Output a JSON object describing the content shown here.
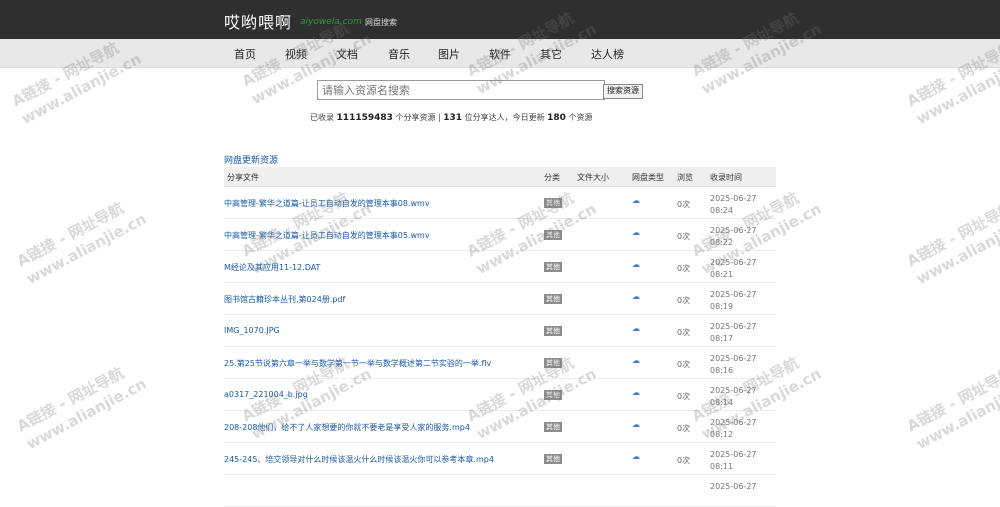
{
  "header": {
    "brand": "哎哟喂啊",
    "domain": "aiyowela.com",
    "subtitle": "网盘搜索"
  },
  "nav": [
    "首页",
    "视频",
    "文档",
    "音乐",
    "图片",
    "软件",
    "其它",
    "达人榜"
  ],
  "search": {
    "placeholder": "请输入资源名搜索",
    "button_label": "搜索资源"
  },
  "stats": {
    "prefix": "已收录",
    "total": "111159483",
    "mid1": "个分享资源 |",
    "sharers": "131",
    "mid2": "位分享达人，今日更新",
    "today": "180",
    "suffix": "个资源"
  },
  "section_title": "网盘更新资源",
  "table": {
    "headers": [
      "分享文件",
      "分类",
      "文件大小",
      "网盘类型",
      "浏览",
      "收录时间"
    ],
    "rows": [
      {
        "file": "中高管理-繁华之道篇-让员工自动自发的管理本事08.wmv",
        "category": "其他",
        "size": "",
        "views": "0次",
        "date": "2025-06-27",
        "time": "08:24"
      },
      {
        "file": "中高管理-繁华之道篇-让员工自动自发的管理本事05.wmv",
        "category": "其他",
        "size": "",
        "views": "0次",
        "date": "2025-06-27",
        "time": "08:22"
      },
      {
        "file": "M经论及其应用11-12.DAT",
        "category": "其他",
        "size": "",
        "views": "0次",
        "date": "2025-06-27",
        "time": "08:21"
      },
      {
        "file": "图书馆古籍珍本丛刊,第024册.pdf",
        "category": "其他",
        "size": "",
        "views": "0次",
        "date": "2025-06-27",
        "time": "08:19"
      },
      {
        "file": "IMG_1070.JPG",
        "category": "其他",
        "size": "",
        "views": "0次",
        "date": "2025-06-27",
        "time": "08:17"
      },
      {
        "file": "25.第25节说第六章一举与数学第一节一举与数学概述第二节实验的一举.flv",
        "category": "其他",
        "size": "",
        "views": "0次",
        "date": "2025-06-27",
        "time": "08:16"
      },
      {
        "file": "a0317_221004_b.jpg",
        "category": "其他",
        "size": "",
        "views": "0次",
        "date": "2025-06-27",
        "time": "08:14"
      },
      {
        "file": "208-208他们，给不了人家想要的你就不要老是享受人家的服务.mp4",
        "category": "其他",
        "size": "",
        "views": "0次",
        "date": "2025-06-27",
        "time": "08:12"
      },
      {
        "file": "245-245、培交领导对什么时候该温火什么时候该温火你可以参考本章.mp4",
        "category": "其他",
        "size": "",
        "views": "0次",
        "date": "2025-06-27",
        "time": "08:11"
      }
    ],
    "partial_row_date": "2025-06-27"
  },
  "watermark": {
    "line1": "A链接 - 网址导航",
    "line2": "www.alianjie.cn"
  }
}
